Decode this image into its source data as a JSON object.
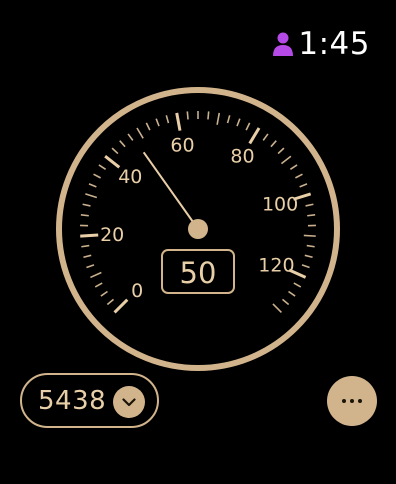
{
  "status": {
    "time": "1:45",
    "user_icon": "person-icon",
    "user_icon_color": "#b64ae6"
  },
  "gauge": {
    "min": 0,
    "max": 130,
    "labels": [
      "0",
      "20",
      "40",
      "60",
      "80",
      "100",
      "120"
    ],
    "needle_value": 48,
    "speed_readout": "50",
    "accent": "#d2b48c"
  },
  "odometer": {
    "value": "5438",
    "icon": "chevron-down-icon"
  },
  "more_button": {
    "icon": "ellipsis-icon"
  }
}
